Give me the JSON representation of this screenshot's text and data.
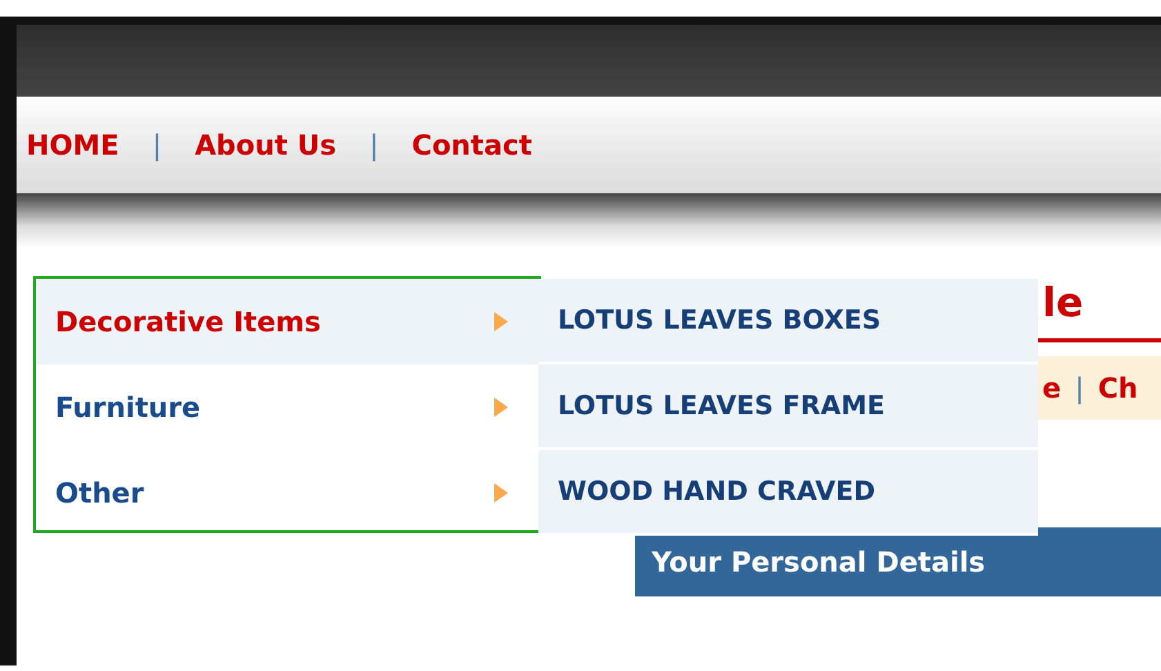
{
  "top_nav": {
    "links": [
      {
        "label": "HOME"
      },
      {
        "label": "About Us"
      },
      {
        "label": "Contact"
      }
    ],
    "separators": [
      "|",
      "|"
    ]
  },
  "page_title": "le",
  "breadcrumb": {
    "items": [
      "e",
      "Ch"
    ],
    "separator": "|"
  },
  "category_menu": {
    "items": [
      {
        "label": "Decorative Items",
        "selected": true
      },
      {
        "label": "Furniture",
        "selected": false
      },
      {
        "label": "Other",
        "selected": false
      }
    ]
  },
  "submenu": {
    "items": [
      {
        "label": "LOTUS LEAVES BOXES"
      },
      {
        "label": "LOTUS LEAVES FRAME"
      },
      {
        "label": "WOOD HAND CRAVED"
      }
    ]
  },
  "section_header": {
    "title": "Your Personal Details"
  }
}
